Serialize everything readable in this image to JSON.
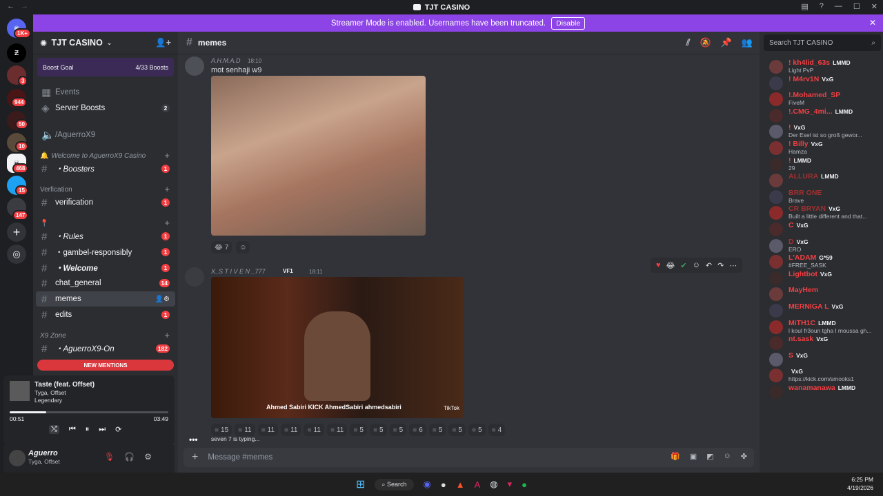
{
  "window": {
    "title": "TJT CASINO"
  },
  "banner": {
    "text": "Streamer Mode is enabled. Usernames have been truncated.",
    "button": "Disable"
  },
  "guild_badges": {
    "g0": "1K+",
    "g1": "3",
    "g2": "944",
    "g3": "50",
    "g4": "10",
    "g5": "468",
    "g6": "15",
    "g7": "147"
  },
  "server": {
    "name": "TJT CASINO",
    "boost_goal": "Boost Goal",
    "boost_count": "4/33 Boosts"
  },
  "sidebar": {
    "events": "Events",
    "server_boosts": "Server Boosts",
    "server_boosts_count": "2",
    "voice": "/AguerroX9",
    "cat_welcome": "Welcome to AguerroX9 Casino",
    "boosters": "・Boosters",
    "boosters_count": "1",
    "cat_verification": "Verfication",
    "verification": "verification",
    "verification_count": "1",
    "rules": "・Rules",
    "rules_count": "1",
    "gambel": "・gambel-responsibly",
    "gambel_count": "1",
    "welcome": "・Welcome",
    "welcome_count": "1",
    "chat_general": "chat_general",
    "chat_general_count": "14",
    "memes": "memes",
    "edits": "edits",
    "edits_count": "1",
    "cat_x9": "X9 Zone",
    "agx9": "・AguerroX9-On",
    "agx9_count": "182",
    "new_mentions": "NEW MENTIONS"
  },
  "player": {
    "title": "Taste (feat. Offset)",
    "artist": "Tyga, Offset",
    "album": "Legendary",
    "elapsed": "00:51",
    "total": "03:49",
    "progress": 0.23
  },
  "user": {
    "name": "Aguerro",
    "status": "Tyga, Offset"
  },
  "channel": {
    "name": "memes",
    "search_placeholder": "Search TJT CASINO"
  },
  "messages": [
    {
      "author": "A.H.M.A.D",
      "time": "18:10",
      "text": "mot senhaji w9",
      "reactions": [
        {
          "emoji": "😂",
          "count": "7"
        }
      ]
    },
    {
      "author": "X_S T I V E N _777",
      "time": "18:11",
      "tag": "VF1",
      "video_caption": "Ahmed Sabiri  KICK AhmedSabiri  ahmedsabiri",
      "tiktok": "TikTok"
    }
  ],
  "reaction_counts": [
    "15",
    "11",
    "11",
    "11",
    "11",
    "11",
    "5",
    "5",
    "5",
    "6",
    "5",
    "5",
    "5",
    "4"
  ],
  "typing": "seven 7 is typing...",
  "composer_placeholder": "Message #memes",
  "members": [
    {
      "name": "! kh4lid_63s",
      "tag": "LMMD",
      "status": "Light PvP",
      "color": "#f23f43"
    },
    {
      "name": "! M4rv1N",
      "tag": "VxG",
      "status": "",
      "color": "#f23f43"
    },
    {
      "name": "!.Mohamed_SP",
      "tag": "",
      "status": "FiveM",
      "color": "#f23f43"
    },
    {
      "name": "!.CMG_4mi...",
      "tag": "LMMD",
      "status": "",
      "color": "#f23f43"
    },
    {
      "name": "!",
      "tag": "VxG",
      "status": "Der Esel ist so groß gewor...",
      "color": "#f23f43"
    },
    {
      "name": "! Billy",
      "tag": "VxG",
      "status": "Hamza",
      "color": "#f23f43"
    },
    {
      "name": "!",
      "tag": "LMMD",
      "status": "29",
      "color": "#f23f43"
    },
    {
      "name": "ALLURA",
      "tag": "LMMD",
      "status": "",
      "color": "#a03030"
    },
    {
      "name": "BRR ONE",
      "tag": "",
      "status": "Brave",
      "color": "#a03030"
    },
    {
      "name": "CR BRYAN",
      "tag": "VxG",
      "status": "Built a little different and that...",
      "color": "#a03030"
    },
    {
      "name": "C",
      "tag": "VxG",
      "status": "",
      "color": "#f23f43"
    },
    {
      "name": "D",
      "tag": "VxG",
      "status": "ERO",
      "color": "#a03030"
    },
    {
      "name": "L'ADAM",
      "tag": "G*59",
      "status": "#FREE_SASK",
      "color": "#f23f43"
    },
    {
      "name": "Lightbot",
      "tag": "VxG",
      "status": "",
      "color": "#f23f43"
    },
    {
      "name": "MayHem",
      "tag": "",
      "status": "",
      "color": "#f23f43"
    },
    {
      "name": "MERNIGA L",
      "tag": "VxG",
      "status": "",
      "color": "#f23f43"
    },
    {
      "name": "MiTH1C",
      "tag": "LMMD",
      "status": "l koul fr3oun tgha l moussa gh...",
      "color": "#f23f43"
    },
    {
      "name": "nt.sask",
      "tag": "VxG",
      "status": "",
      "color": "#f23f43"
    },
    {
      "name": "S",
      "tag": "VxG",
      "status": "",
      "color": "#f23f43"
    },
    {
      "name": "",
      "tag": "VxG",
      "status": "https://kick.com/smooks1",
      "color": "#f23f43"
    },
    {
      "name": "wanamanawa",
      "tag": "LMMD",
      "status": "",
      "color": "#f23f43"
    }
  ],
  "taskbar": {
    "search": "Search",
    "time": "6:25 PM",
    "date": "4/19/2026"
  }
}
